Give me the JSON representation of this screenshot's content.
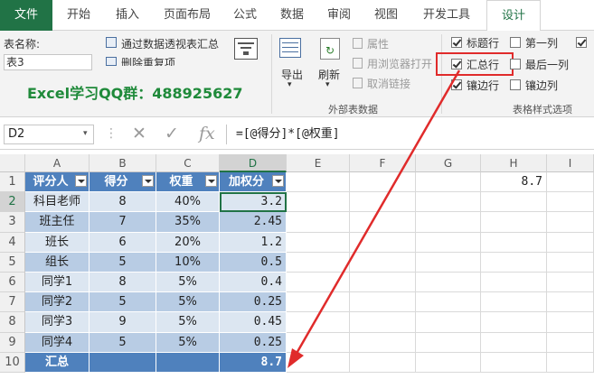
{
  "ribbon_tabs": [
    "文件",
    "开始",
    "插入",
    "页面布局",
    "公式",
    "数据",
    "审阅",
    "视图",
    "开发工具",
    "设计"
  ],
  "ribbon": {
    "table_name_label": "表名称:",
    "table_name_value": "表3",
    "summarize_pivot": "通过数据透视表汇总",
    "remove_duplicates": "删除重复项",
    "export": "导出",
    "refresh": "刷新",
    "properties": "属性",
    "open_in_browser": "用浏览器打开",
    "unlink": "取消链接",
    "external_group": "外部表数据",
    "style_options_group": "表格样式选项",
    "options": {
      "header_row": "标题行",
      "total_row": "汇总行",
      "banded_rows": "镶边行",
      "first_column": "第一列",
      "last_column": "最后一列",
      "banded_columns": "镶边列"
    },
    "watermark": "Excel学习QQ群：488925627"
  },
  "formula_bar": {
    "name_box": "D2",
    "formula": "=[@得分]*[@权重]"
  },
  "sheet": {
    "columns": [
      "A",
      "B",
      "C",
      "D",
      "E",
      "F",
      "G",
      "H",
      "I"
    ],
    "rows": [
      "1",
      "2",
      "3",
      "4",
      "5",
      "6",
      "7",
      "8",
      "9",
      "10"
    ],
    "headers": [
      "评分人",
      "得分",
      "权重",
      "加权分"
    ],
    "data": [
      [
        "科目老师",
        "8",
        "40%",
        "3.2"
      ],
      [
        "班主任",
        "7",
        "35%",
        "2.45"
      ],
      [
        "班长",
        "6",
        "20%",
        "1.2"
      ],
      [
        "组长",
        "5",
        "10%",
        "0.5"
      ],
      [
        "同学1",
        "8",
        "5%",
        "0.4"
      ],
      [
        "同学2",
        "5",
        "5%",
        "0.25"
      ],
      [
        "同学3",
        "9",
        "5%",
        "0.45"
      ],
      [
        "同学4",
        "5",
        "5%",
        "0.25"
      ]
    ],
    "total_label": "汇总",
    "total_value": "8.7",
    "h1_value": "8.7"
  },
  "colors": {
    "excel_green": "#217346",
    "table_header": "#4f81bd",
    "band_light": "#dce6f1",
    "band_dark": "#b8cce4",
    "annotation_red": "#e02b2b",
    "watermark_green": "#1f8a3a"
  }
}
